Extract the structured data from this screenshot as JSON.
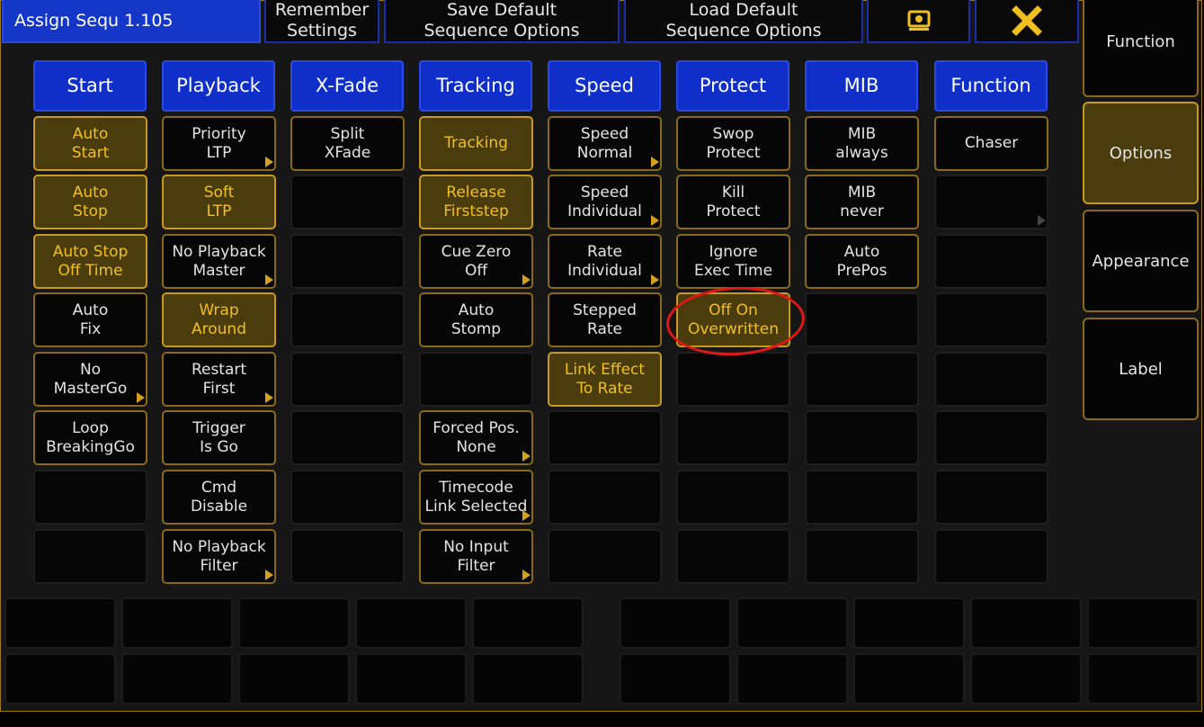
{
  "title": "Assign Sequ 1.105",
  "toolbar": {
    "remember": [
      "Remember",
      "Settings"
    ],
    "save_default": [
      "Save Default",
      "Sequence Options"
    ],
    "load_default": [
      "Load Default",
      "Sequence Options"
    ],
    "screenshot_icon": "camera-icon",
    "close_icon": "close-icon",
    "accent_color": "#f0c020"
  },
  "side_tabs": [
    {
      "label": "Function",
      "active": false
    },
    {
      "label": "Options",
      "active": true
    },
    {
      "label": "Appearance",
      "active": false
    },
    {
      "label": "Label",
      "active": false
    }
  ],
  "columns": [
    {
      "header": "Start",
      "cells": [
        {
          "lines": [
            "Auto",
            "Start"
          ],
          "active": true
        },
        {
          "lines": [
            "Auto",
            "Stop"
          ],
          "active": true
        },
        {
          "lines": [
            "Auto Stop",
            "Off Time"
          ],
          "active": true
        },
        {
          "lines": [
            "Auto",
            "Fix"
          ]
        },
        {
          "lines": [
            "No",
            "MasterGo"
          ],
          "arrow": true
        },
        {
          "lines": [
            "Loop",
            "BreakingGo"
          ]
        },
        {
          "lines": []
        },
        {
          "lines": []
        }
      ]
    },
    {
      "header": "Playback",
      "cells": [
        {
          "lines": [
            "Priority",
            "LTP"
          ],
          "arrow": true
        },
        {
          "lines": [
            "Soft",
            "LTP"
          ],
          "active": true
        },
        {
          "lines": [
            "No Playback",
            "Master"
          ],
          "arrow": true
        },
        {
          "lines": [
            "Wrap",
            "Around"
          ],
          "active": true
        },
        {
          "lines": [
            "Restart",
            "First"
          ],
          "arrow": true
        },
        {
          "lines": [
            "Trigger",
            "Is Go"
          ]
        },
        {
          "lines": [
            "Cmd",
            "Disable"
          ]
        },
        {
          "lines": [
            "No Playback",
            "Filter"
          ],
          "arrow": true
        }
      ]
    },
    {
      "header": "X-Fade",
      "cells": [
        {
          "lines": [
            "Split",
            "XFade"
          ]
        },
        {
          "lines": []
        },
        {
          "lines": []
        },
        {
          "lines": []
        },
        {
          "lines": []
        },
        {
          "lines": []
        },
        {
          "lines": []
        },
        {
          "lines": []
        }
      ]
    },
    {
      "header": "Tracking",
      "cells": [
        {
          "lines": [
            "Tracking"
          ],
          "active": true
        },
        {
          "lines": [
            "Release",
            "Firststep"
          ],
          "active": true
        },
        {
          "lines": [
            "Cue Zero",
            "Off"
          ],
          "arrow": true
        },
        {
          "lines": [
            "Auto",
            "Stomp"
          ]
        },
        {
          "lines": []
        },
        {
          "lines": [
            "Forced Pos.",
            "None"
          ],
          "arrow": true
        },
        {
          "lines": [
            "Timecode",
            "Link Selected"
          ],
          "arrow": true
        },
        {
          "lines": [
            "No Input",
            "Filter"
          ],
          "arrow": true
        }
      ]
    },
    {
      "header": "Speed",
      "cells": [
        {
          "lines": [
            "Speed",
            "Normal"
          ],
          "arrow": true
        },
        {
          "lines": [
            "Speed",
            "Individual"
          ],
          "arrow": true
        },
        {
          "lines": [
            "Rate",
            "Individual"
          ],
          "arrow": true
        },
        {
          "lines": [
            "Stepped",
            "Rate"
          ]
        },
        {
          "lines": [
            "Link Effect",
            "To Rate"
          ],
          "active": true
        },
        {
          "lines": []
        },
        {
          "lines": []
        },
        {
          "lines": []
        }
      ]
    },
    {
      "header": "Protect",
      "cells": [
        {
          "lines": [
            "Swop",
            "Protect"
          ]
        },
        {
          "lines": [
            "Kill",
            "Protect"
          ]
        },
        {
          "lines": [
            "Ignore",
            "Exec Time"
          ]
        },
        {
          "lines": [
            "Off On",
            "Overwritten"
          ],
          "active": true,
          "highlighted": true
        },
        {
          "lines": []
        },
        {
          "lines": []
        },
        {
          "lines": []
        },
        {
          "lines": []
        }
      ]
    },
    {
      "header": "MIB",
      "cells": [
        {
          "lines": [
            "MIB",
            "always"
          ]
        },
        {
          "lines": [
            "MIB",
            "never"
          ]
        },
        {
          "lines": [
            "Auto",
            "PrePos"
          ]
        },
        {
          "lines": []
        },
        {
          "lines": []
        },
        {
          "lines": []
        },
        {
          "lines": []
        },
        {
          "lines": []
        }
      ]
    },
    {
      "header": "Function",
      "cells": [
        {
          "lines": [
            "Chaser"
          ]
        },
        {
          "lines": [],
          "arrow": true,
          "dim_arrow": true
        },
        {
          "lines": []
        },
        {
          "lines": []
        },
        {
          "lines": []
        },
        {
          "lines": []
        },
        {
          "lines": []
        },
        {
          "lines": []
        }
      ]
    }
  ]
}
